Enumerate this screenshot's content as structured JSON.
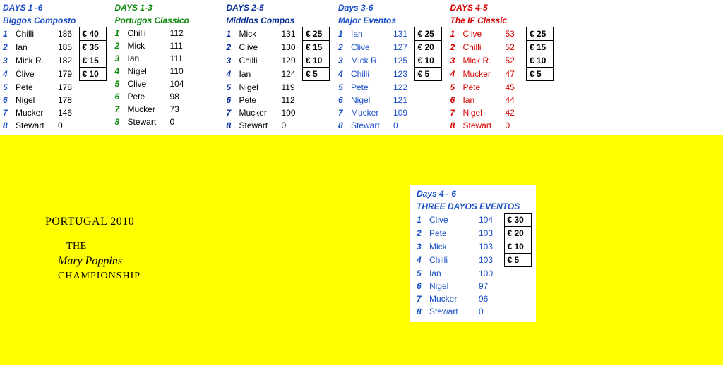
{
  "competitions_top": [
    {
      "theme": "c-biggos",
      "days": "DAYS 1 -6",
      "name": "Biggos Composto",
      "rows": [
        {
          "rank": "1",
          "name": "Chilli",
          "score": "186",
          "prize": "€ 40"
        },
        {
          "rank": "2",
          "name": "Ian",
          "score": "185",
          "prize": "€ 35"
        },
        {
          "rank": "3",
          "name": "Mick R.",
          "score": "182",
          "prize": "€ 15"
        },
        {
          "rank": "4",
          "name": "Clive",
          "score": "179",
          "prize": "€ 10"
        },
        {
          "rank": "5",
          "name": "Pete",
          "score": "178",
          "prize": ""
        },
        {
          "rank": "6",
          "name": "Nigel",
          "score": "178",
          "prize": ""
        },
        {
          "rank": "7",
          "name": "Mucker",
          "score": "146",
          "prize": ""
        },
        {
          "rank": "8",
          "name": "Stewart",
          "score": "0",
          "prize": ""
        }
      ]
    },
    {
      "theme": "c-portugos",
      "days": "DAYS 1-3",
      "name": "Portugos Classico",
      "rows": [
        {
          "rank": "1",
          "name": "Chilli",
          "score": "112",
          "prize": ""
        },
        {
          "rank": "2",
          "name": "Mick",
          "score": "111",
          "prize": ""
        },
        {
          "rank": "3",
          "name": "Ian",
          "score": "111",
          "prize": ""
        },
        {
          "rank": "4",
          "name": "Nigel",
          "score": "110",
          "prize": ""
        },
        {
          "rank": "5",
          "name": "Clive",
          "score": "104",
          "prize": ""
        },
        {
          "rank": "6",
          "name": "Pete",
          "score": "98",
          "prize": ""
        },
        {
          "rank": "7",
          "name": "Mucker",
          "score": "73",
          "prize": ""
        },
        {
          "rank": "8",
          "name": "Stewart",
          "score": "0",
          "prize": ""
        }
      ]
    },
    {
      "theme": "c-middlos",
      "days": "DAYS 2-5",
      "name": "Middlos Compos",
      "rows": [
        {
          "rank": "1",
          "name": "Mick",
          "score": "131",
          "prize": "€ 25"
        },
        {
          "rank": "2",
          "name": "Clive",
          "score": "130",
          "prize": "€ 15"
        },
        {
          "rank": "3",
          "name": "Chilli",
          "score": "129",
          "prize": "€ 10"
        },
        {
          "rank": "4",
          "name": "Ian",
          "score": "124",
          "prize": "€ 5"
        },
        {
          "rank": "5",
          "name": "Nigel",
          "score": "119",
          "prize": ""
        },
        {
          "rank": "6",
          "name": "Pete",
          "score": "112",
          "prize": ""
        },
        {
          "rank": "7",
          "name": "Mucker",
          "score": "100",
          "prize": ""
        },
        {
          "rank": "8",
          "name": "Stewart",
          "score": "0",
          "prize": ""
        }
      ]
    },
    {
      "theme": "c-major",
      "days": "Days 3-6",
      "name": "Major Eventos",
      "rows": [
        {
          "rank": "1",
          "name": "Ian",
          "score": "131",
          "prize": "€ 25"
        },
        {
          "rank": "2",
          "name": "Clive",
          "score": "127",
          "prize": "€ 20"
        },
        {
          "rank": "3",
          "name": "Mick R.",
          "score": "125",
          "prize": "€ 10"
        },
        {
          "rank": "4",
          "name": "Chilli",
          "score": "123",
          "prize": "€ 5"
        },
        {
          "rank": "5",
          "name": "Pete",
          "score": "122",
          "prize": ""
        },
        {
          "rank": "6",
          "name": "Nigel",
          "score": "121",
          "prize": ""
        },
        {
          "rank": "7",
          "name": "Mucker",
          "score": "109",
          "prize": ""
        },
        {
          "rank": "8",
          "name": "Stewart",
          "score": "0",
          "prize": ""
        }
      ]
    },
    {
      "theme": "c-if",
      "days": "DAYS 4-5",
      "name": "The IF Classic",
      "rows": [
        {
          "rank": "1",
          "name": "Clive",
          "score": "53",
          "prize": "€ 25"
        },
        {
          "rank": "2",
          "name": "Chilli",
          "score": "52",
          "prize": "€ 15"
        },
        {
          "rank": "3",
          "name": "Mick R.",
          "score": "52",
          "prize": "€ 10"
        },
        {
          "rank": "4",
          "name": "Mucker",
          "score": "47",
          "prize": "€ 5"
        },
        {
          "rank": "5",
          "name": "Pete",
          "score": "45",
          "prize": ""
        },
        {
          "rank": "6",
          "name": "Ian",
          "score": "44",
          "prize": ""
        },
        {
          "rank": "7",
          "name": "Nigel",
          "score": "42",
          "prize": ""
        },
        {
          "rank": "8",
          "name": "Stewart",
          "score": "0",
          "prize": ""
        }
      ]
    }
  ],
  "competition_bottom": {
    "theme": "c-three",
    "days": "Days 4 - 6",
    "name": "THREE DAYOS EVENTOS",
    "rows": [
      {
        "rank": "1",
        "name": "Clive",
        "score": "104",
        "prize": "€ 30"
      },
      {
        "rank": "2",
        "name": "Pete",
        "score": "103",
        "prize": "€ 20"
      },
      {
        "rank": "3",
        "name": "Mick",
        "score": "103",
        "prize": "€ 10"
      },
      {
        "rank": "4",
        "name": "Chilli",
        "score": "103",
        "prize": "€ 5"
      },
      {
        "rank": "5",
        "name": "Ian",
        "score": "100",
        "prize": ""
      },
      {
        "rank": "6",
        "name": "Nigel",
        "score": "97",
        "prize": ""
      },
      {
        "rank": "7",
        "name": "Mucker",
        "score": "96",
        "prize": ""
      },
      {
        "rank": "8",
        "name": "Stewart",
        "score": "0",
        "prize": ""
      }
    ]
  },
  "caption": {
    "line1": "PORTUGAL 2010",
    "line2": "THE",
    "line3": "Mary Poppins",
    "line4": "CHAMPIONSHIP"
  }
}
